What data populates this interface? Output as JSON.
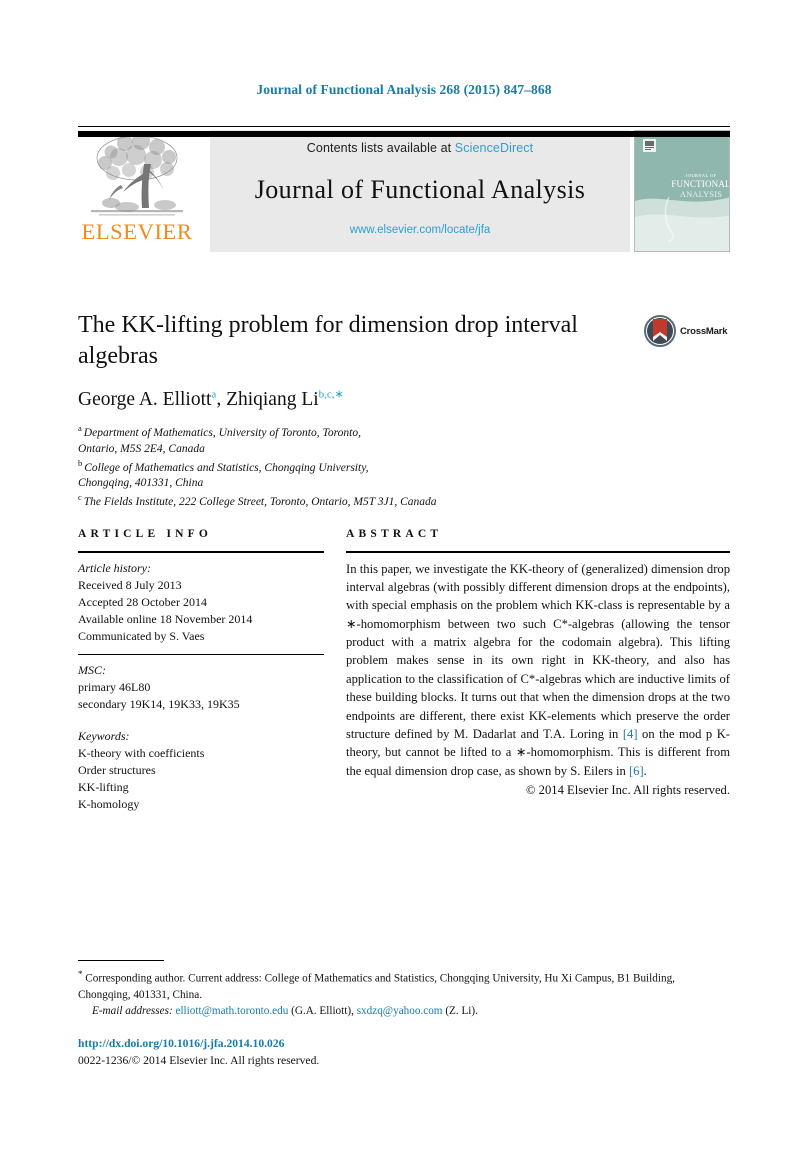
{
  "running_head": "Journal of Functional Analysis 268 (2015) 847–868",
  "masthead": {
    "contents_prefix": "Contents lists available at ",
    "sciencedirect": "ScienceDirect",
    "journal_name": "Journal of Functional Analysis",
    "journal_url": "www.elsevier.com/locate/jfa",
    "publisher_wordmark": "ELSEVIER",
    "publisher_logo_icon": "elsevier-tree-icon",
    "cover_title_small": "JOURNAL OF",
    "cover_title_main_1": "FUNCTIONAL",
    "cover_title_main_2": "ANALYSIS",
    "cover_color": "#8fb8ae",
    "link_color": "#2b9fd4",
    "wordmark_color": "#f08a1c"
  },
  "article": {
    "title": "The KK-lifting problem for dimension drop interval algebras",
    "crossmark_label": "CrossMark",
    "crossmark_icon": "crossmark-badge-icon",
    "authors": [
      {
        "name": "George A. Elliott",
        "marks": "a"
      },
      {
        "name": "Zhiqiang Li",
        "marks": "b,c,∗"
      }
    ],
    "authors_separator": ", ",
    "affiliations": [
      {
        "mark": "a",
        "line1": "Department of Mathematics, University of Toronto, Toronto,",
        "line2": "Ontario, M5S 2E4, Canada"
      },
      {
        "mark": "b",
        "line1": "College of Mathematics and Statistics, Chongqing University,",
        "line2": "Chongqing, 401331, China"
      },
      {
        "mark": "c",
        "line1": "The Fields Institute, 222 College Street, Toronto, Ontario, M5T 3J1, Canada",
        "line2": ""
      }
    ]
  },
  "info": {
    "heading": "ARTICLE INFO",
    "history_label": "Article history:",
    "history": [
      "Received 8 July 2013",
      "Accepted 28 October 2014",
      "Available online 18 November 2014",
      "Communicated by S. Vaes"
    ],
    "msc_label": "MSC:",
    "msc": [
      "primary 46L80",
      "secondary 19K14, 19K33, 19K35"
    ],
    "keywords_label": "Keywords:",
    "keywords": [
      "K-theory with coefficients",
      "Order structures",
      "KK-lifting",
      "K-homology"
    ]
  },
  "abstract": {
    "heading": "ABSTRACT",
    "part1": "In this paper, we investigate the KK-theory of (generalized) dimension drop interval algebras (with possibly different dimension drops at the endpoints), with special emphasis on the problem which KK-class is representable by a ∗-homomorphism between two such C*-algebras (allowing the tensor product with a matrix algebra for the codomain algebra). This lifting problem makes sense in its own right in KK-theory, and also has application to the classification of C*-algebras which are inductive limits of these building blocks. It turns out that when the dimension drops at the two endpoints are different, there exist KK-elements which preserve the order structure defined by M. Dadarlat and T.A. Loring in ",
    "ref1": "[4]",
    "part2": " on the mod p K-theory, but cannot be lifted to a ∗-homomorphism. This is different from the equal dimension drop case, as shown by S. Eilers in ",
    "ref2": "[6]",
    "part3": ".",
    "copyright": "© 2014 Elsevier Inc. All rights reserved."
  },
  "footnotes": {
    "corresponding_mark": "*",
    "corresponding_text": "Corresponding author. Current address: College of Mathematics and Statistics, Chongqing University, Hu Xi Campus, B1 Building, Chongqing, 401331, China.",
    "email_label": "E-mail addresses:",
    "emails": [
      {
        "address": "elliott@math.toronto.edu",
        "owner": "(G.A. Elliott)"
      },
      {
        "address": "sxdzq@yahoo.com",
        "owner": "(Z. Li)"
      }
    ],
    "email_separator": ", ",
    "email_end": "."
  },
  "bottom": {
    "doi": "http://dx.doi.org/10.1016/j.jfa.2014.10.026",
    "issn_line": "0022-1236/© 2014 Elsevier Inc. All rights reserved."
  }
}
